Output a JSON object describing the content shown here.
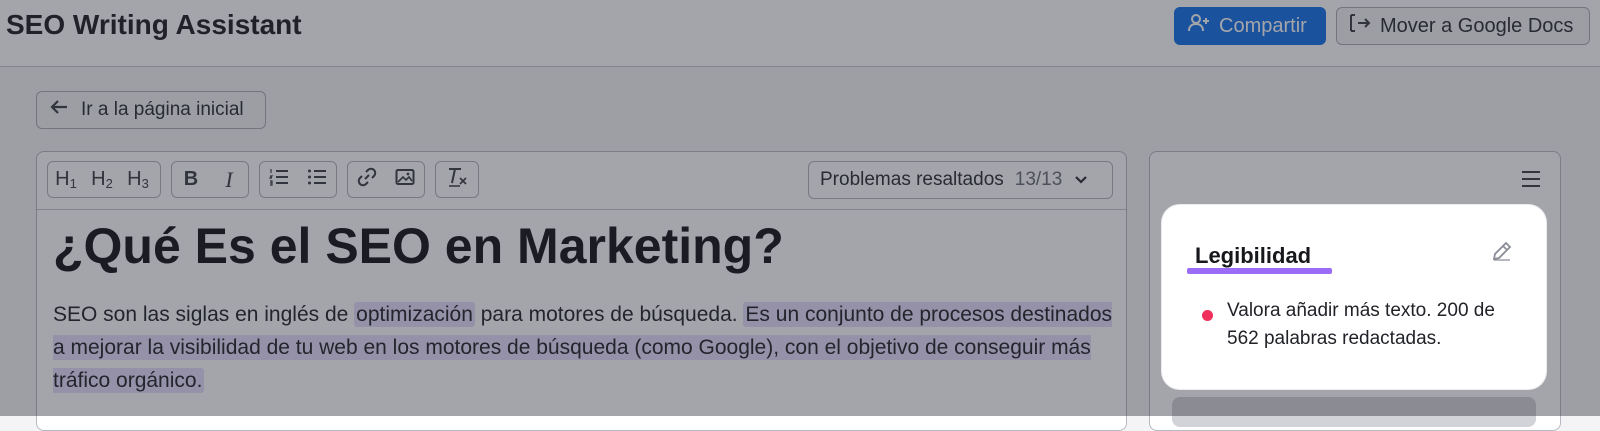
{
  "header": {
    "title": "SEO Writing Assistant",
    "share_label": "Compartir",
    "docs_label": "Mover a Google Docs"
  },
  "nav": {
    "back_label": "Ir a la página inicial"
  },
  "toolbar": {
    "h1": "H",
    "h1_sub": "1",
    "h2": "H",
    "h2_sub": "2",
    "h3": "H",
    "h3_sub": "3",
    "bold": "B",
    "italic": "I",
    "issues_label": "Problemas resaltados",
    "issues_count": "13/13"
  },
  "document": {
    "heading": "¿Qué Es el SEO en Marketing?",
    "para_part1": "SEO son las siglas en inglés de ",
    "para_hl1": "optimización",
    "para_part2": " para motores de búsqueda. ",
    "para_hl2": "Es un conjunto de procesos destinados a mejorar la visibilidad de tu web en los motores de búsqueda (como Google), con el objetivo de conseguir más tráfico orgánico."
  },
  "panel": {
    "card_title": "Legibilidad",
    "tip_text": "Valora añadir más texto. 200 de 562 palabras redactadas."
  },
  "colors": {
    "primary": "#1270e8",
    "highlight": "#e5dcfc",
    "underline": "#9b6cf5",
    "alert_dot": "#f0305a"
  },
  "icons": [
    "add-user-icon",
    "export-icon",
    "arrow-left-icon",
    "ordered-list-icon",
    "bullet-list-icon",
    "link-icon",
    "image-icon",
    "clear-format-icon",
    "chevron-down-icon",
    "menu-icon",
    "edit-icon"
  ]
}
